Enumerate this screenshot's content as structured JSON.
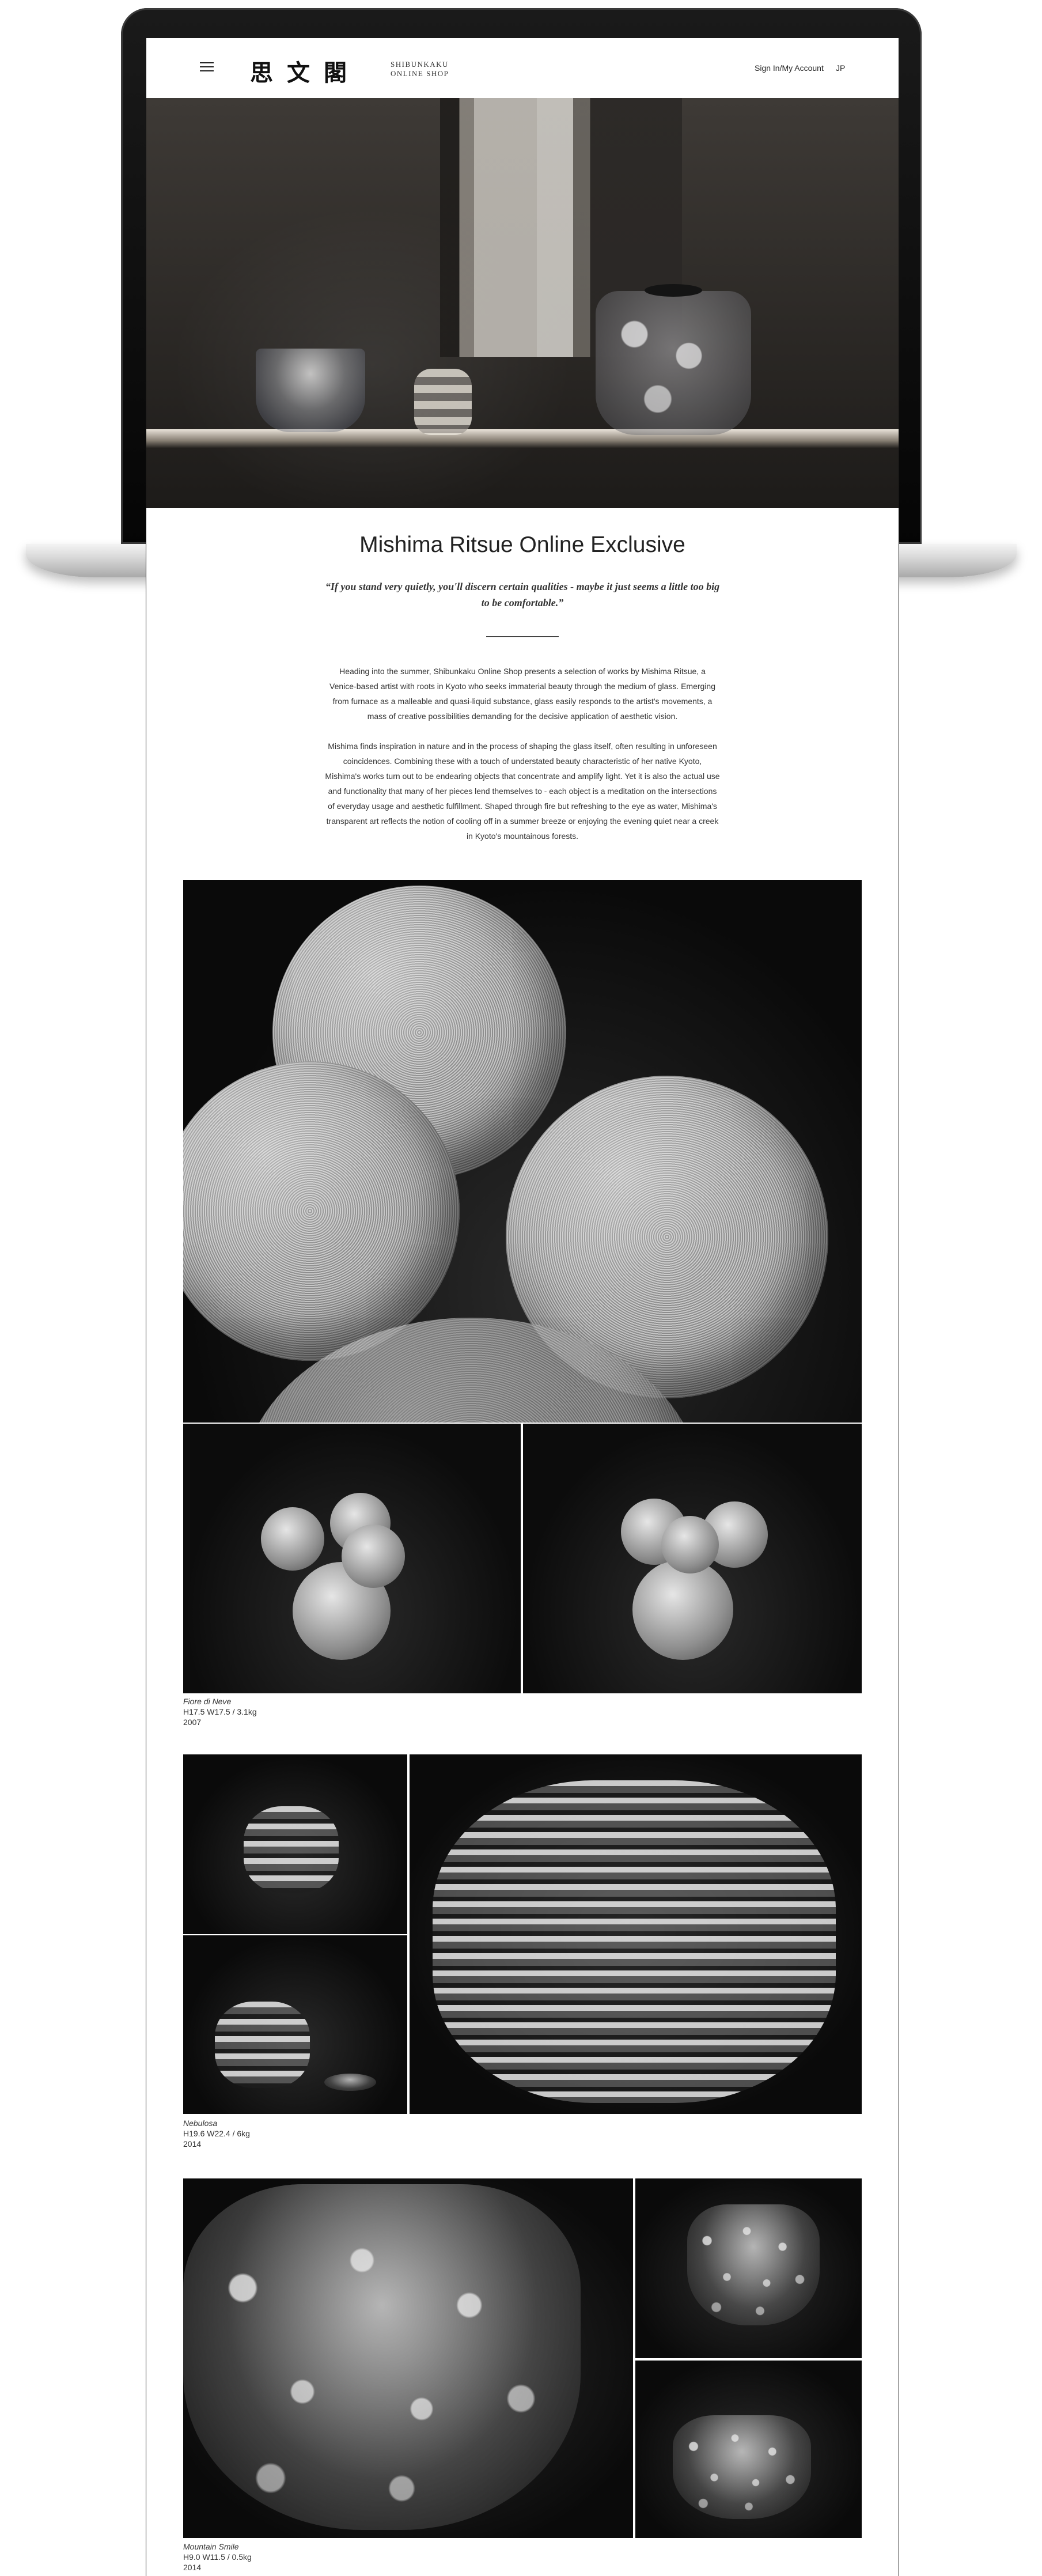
{
  "header": {
    "logo_kanji": "思文閣",
    "logo_line1": "SHIBUNKAKU",
    "logo_line2": "ONLINE SHOP",
    "signin_label": "Sign In/My Account",
    "lang_label": "JP",
    "menu_icon": "hamburger-menu-icon"
  },
  "intro": {
    "title": "Mishima Ritsue Online Exclusive",
    "quote": "“If you stand very quietly, you'll discern certain qualities - maybe it just seems a little too big to be comfortable.”",
    "paragraph1": "Heading into the summer, Shibunkaku Online Shop presents a selection of works by Mishima Ritsue, a Venice-based artist with roots in Kyoto who seeks immaterial beauty through the medium of glass. Emerging from furnace as a malleable and quasi-liquid substance, glass easily responds to the artist's movements, a mass of creative possibilities demanding for the decisive application of aesthetic vision.",
    "paragraph2": "Mishima finds inspiration in nature and in the process of shaping the glass itself, often resulting in unforeseen coincidences. Combining these with a touch of understated beauty characteristic of her native Kyoto, Mishima's works turn out to be endearing objects that concentrate and amplify light. Yet it is also the actual use and functionality that many of her pieces lend themselves to - each object is a meditation on the intersections of everyday usage and aesthetic fulfillment. Shaped through fire but refreshing to the eye as water, Mishima's transparent art reflects the notion of cooling off in a summer breeze or enjoying the evening quiet near a creek in Kyoto's mountainous forests."
  },
  "works": [
    {
      "title": "Fiore di Neve",
      "dimensions": "H17.5 W17.5 / 3.1kg",
      "year": "2007"
    },
    {
      "title": "Nebulosa",
      "dimensions": "H19.6 W22.4 / 6kg",
      "year": "2014"
    },
    {
      "title": "Mountain Smile",
      "dimensions": "H9.0 W11.5 / 0.5kg",
      "year": "2014"
    }
  ]
}
